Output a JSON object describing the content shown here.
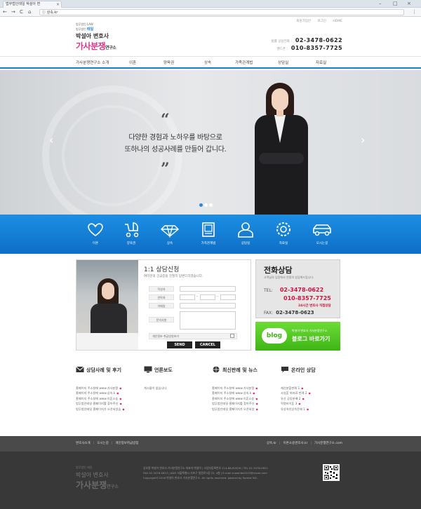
{
  "browser": {
    "tab_title": "법무법인태일 박설아 변",
    "tab_close": "×",
    "window_controls": [
      "–",
      "□",
      "×"
    ],
    "nav": [
      "←",
      "→",
      "C",
      "⌂"
    ],
    "url": "ⓘ 상속.kr",
    "menu": "⋮"
  },
  "header": {
    "util_links": [
      "회원가입안",
      "로그인",
      "HOME"
    ],
    "logo": {
      "small": "법무법인 LAW",
      "name_prefix": "법무법인",
      "brand": "태일",
      "lawyer": "박설아 변호사",
      "title": "가사분쟁",
      "title_suffix": "연구소"
    },
    "contact": [
      {
        "label": "법률 상담전화 :",
        "value": "02-3478-0622"
      },
      {
        "label": "핸드폰 :",
        "value": "010-8357-7725"
      }
    ]
  },
  "gnb": [
    "가사분쟁연구소 소개",
    "이혼",
    "양육권",
    "상속",
    "가족관계법",
    "상담실",
    "자료실"
  ],
  "hero": {
    "quote_open": "“",
    "quote_close": "”",
    "line1": "다양한 경험과 노하우를 바탕으로",
    "line2": "또하나의 성공사례를 만들어 갑니다.",
    "prev": "‹",
    "next": "›",
    "slides": 3,
    "active_slide": 1
  },
  "band": [
    {
      "label": "이혼",
      "icon": "heart-icon"
    },
    {
      "label": "양육권",
      "icon": "stroller-icon"
    },
    {
      "label": "상속",
      "icon": "diamond-icon"
    },
    {
      "label": "가족관계법",
      "icon": "book-icon"
    },
    {
      "label": "상담실",
      "icon": "person-icon"
    },
    {
      "label": "자료실",
      "icon": "gear-icon"
    },
    {
      "label": "오시는길",
      "icon": "car-icon"
    }
  ],
  "consult": {
    "title": "1:1 상담신청",
    "desc": "여러분의 궁금증을 친절히 답변드리겠습니다.",
    "fields": [
      "작성자",
      "연락처",
      "이메일",
      "문의사항"
    ],
    "phone_sep": "-",
    "privacy": "개인정보 취급방침보기",
    "send": "SEND",
    "cancel": "CANCEL"
  },
  "phone_box": {
    "title": "전화상담",
    "desc": "고객님의 입장에서 친절히 상담해드립니다.",
    "tel_label": "TEL:",
    "tel": "02-3478-0622",
    "mobile": "010-8357-7725",
    "note": "24시간 변호사 직접상담",
    "fax_label": "FAX:",
    "fax": "02-3478-0623"
  },
  "blog_box": {
    "bubble": "blog",
    "small": "박설아 변호사 가사분쟁연구소",
    "main": "블로그 바로가기"
  },
  "boards": [
    {
      "title": "상담사례 및 후기",
      "icon": "mail-icon",
      "items": [
        "홈페이지 주소창에 www.가사분쟁",
        "홈페이지 주소창에 www.상속.k",
        "홈페이지 주소창에 www.이혼소송",
        "법무법인태일 홈페이지를 찾아주신",
        "법무법인태일 홈페이지가 오픈되었습"
      ]
    },
    {
      "title": "언론보도",
      "icon": "monitor-icon",
      "items": [
        "게시물이 없습니다."
      ]
    },
    {
      "title": "최신판례 및 뉴스",
      "icon": "globe-icon",
      "items": [
        "홈페이지 주소창에 www.가사분쟁",
        "홈페이지 주소창에 www.상속.k",
        "홈페이지 주소창에 www.이혼소송",
        "법무법인태일 홈페이지를 찾아주신",
        "법무법인태일 홈페이지가 오픈되었"
      ]
    },
    {
      "title": "온라인 상담",
      "icon": "chat-icon",
      "items": [
        "재산분할판례 1",
        "사실혼 위자료 판례 2",
        "유산 공동분배 2",
        "혁명비이혼 3",
        "유상속인상속문제 1"
      ]
    }
  ],
  "footer": {
    "nav_left": [
      "변호사소개",
      "오시는길",
      "개인정보취급방침"
    ],
    "nav_right": [
      "상속.kr",
      "이혼소송변호사.kr",
      "가사분쟁연구소.com"
    ],
    "logo_small": "법무법인 태일",
    "logo_name": "박설아 변호사",
    "logo_title": "가사분쟁",
    "logo_suffix": "연구소",
    "info": [
      "상호명 박설아 변호사 가사분쟁연구소 대표자 박설아 | 사업자등록번호 214-88-62026 | TEL 02-3478-0622",
      "FAX 02-3478-0623 | ADD 서울특별시 서초구 법원로3길 25, 4층 | E-mail snowhite0103@naver.com",
      "Copyright©2016 박설아 변호사 가사분쟁연구소. All rights reserved. powerd by Somist INC."
    ]
  },
  "colors": {
    "accent": "#1a7ecf",
    "pink": "#e2368a",
    "red": "#d2143a",
    "green": "#3db515"
  }
}
